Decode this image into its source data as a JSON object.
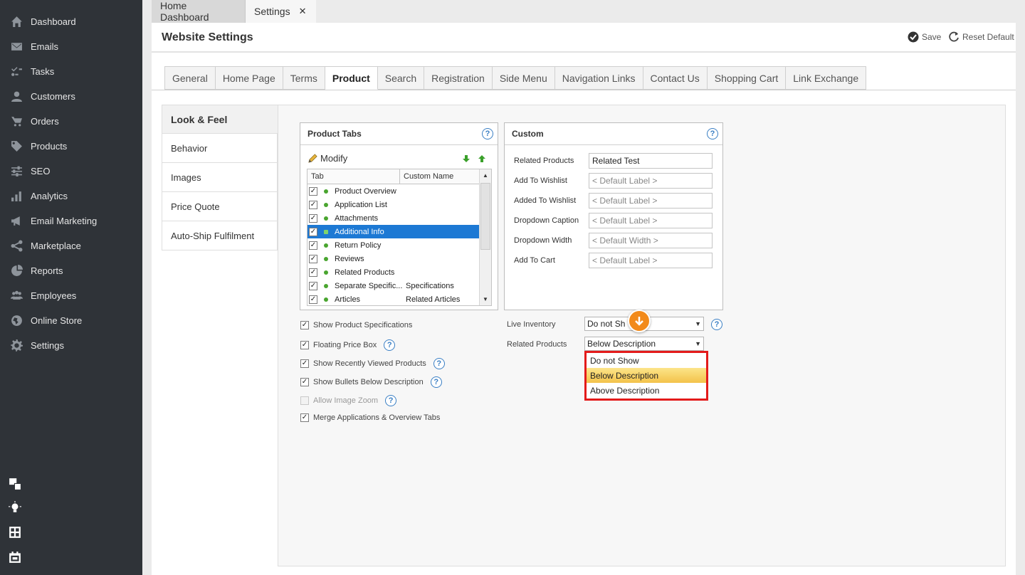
{
  "sidebar": {
    "items": [
      {
        "label": "Dashboard",
        "icon": "home-icon"
      },
      {
        "label": "Emails",
        "icon": "envelope-icon"
      },
      {
        "label": "Tasks",
        "icon": "tasks-icon"
      },
      {
        "label": "Customers",
        "icon": "user-icon"
      },
      {
        "label": "Orders",
        "icon": "cart-icon"
      },
      {
        "label": "Products",
        "icon": "tag-icon"
      },
      {
        "label": "SEO",
        "icon": "sliders-icon"
      },
      {
        "label": "Analytics",
        "icon": "bar-chart-icon"
      },
      {
        "label": "Email Marketing",
        "icon": "megaphone-icon"
      },
      {
        "label": "Marketplace",
        "icon": "share-icon"
      },
      {
        "label": "Reports",
        "icon": "pie-chart-icon"
      },
      {
        "label": "Employees",
        "icon": "users-icon"
      },
      {
        "label": "Online Store",
        "icon": "globe-icon"
      },
      {
        "label": "Settings",
        "icon": "gear-icon"
      }
    ],
    "bottom_icons": [
      "windows-icon",
      "lightbulb-icon",
      "calculator-icon",
      "calendar-icon"
    ]
  },
  "doc_tabs": [
    {
      "label": "Home Dashboard"
    },
    {
      "label": "Settings",
      "close": "✕"
    }
  ],
  "header": {
    "title": "Website Settings",
    "save_label": "Save",
    "reset_label": "Reset Default"
  },
  "settings_tabs": [
    "General",
    "Home Page",
    "Terms",
    "Product",
    "Search",
    "Registration",
    "Side Menu",
    "Navigation Links",
    "Contact Us",
    "Shopping Cart",
    "Link Exchange"
  ],
  "active_settings_tab": "Product",
  "left_nav": [
    "Look & Feel",
    "Behavior",
    "Images",
    "Price Quote",
    "Auto-Ship Fulfilment"
  ],
  "active_left_nav": "Look & Feel",
  "product_tabs": {
    "title": "Product Tabs",
    "help": "?",
    "modify_label": "Modify",
    "columns": [
      "Tab",
      "Custom Name"
    ],
    "rows": [
      {
        "name": "Product Overview",
        "custom": "",
        "checked": true
      },
      {
        "name": "Application List",
        "custom": "",
        "checked": true
      },
      {
        "name": "Attachments",
        "custom": "",
        "checked": true
      },
      {
        "name": "Additional Info",
        "custom": "",
        "checked": true,
        "selected": true
      },
      {
        "name": "Return Policy",
        "custom": "",
        "checked": true
      },
      {
        "name": "Reviews",
        "custom": "",
        "checked": true
      },
      {
        "name": "Related Products",
        "custom": "",
        "checked": true
      },
      {
        "name": "Separate Specific...",
        "custom": "Specifications",
        "checked": true
      },
      {
        "name": "Articles",
        "custom": "Related Articles",
        "checked": true
      }
    ]
  },
  "custom_panel": {
    "title": "Custom",
    "help": "?",
    "fields": [
      {
        "label": "Related Products",
        "value": "Related Test",
        "placeholder": false
      },
      {
        "label": "Add To Wishlist",
        "value": "< Default Label >",
        "placeholder": true
      },
      {
        "label": "Added To Wishlist",
        "value": "< Default Label >",
        "placeholder": true
      },
      {
        "label": "Dropdown  Caption",
        "value": "< Default Label >",
        "placeholder": true
      },
      {
        "label": "Dropdown  Width",
        "value": "< Default Width >",
        "placeholder": true
      },
      {
        "label": "Add To Cart",
        "value": "< Default Label >",
        "placeholder": true
      }
    ]
  },
  "options": [
    {
      "label": "Show Product Specifications",
      "checked": true,
      "help": false,
      "disabled": false
    },
    {
      "label": "Floating Price Box",
      "checked": true,
      "help": true,
      "disabled": false
    },
    {
      "label": "Show Recently Viewed Products",
      "checked": true,
      "help": true,
      "disabled": false
    },
    {
      "label": "Show Bullets Below Description",
      "checked": true,
      "help": true,
      "disabled": false
    },
    {
      "label": "Allow Image Zoom",
      "checked": false,
      "help": true,
      "disabled": true
    },
    {
      "label": "Merge Applications & Overview Tabs",
      "checked": true,
      "help": false,
      "disabled": false
    }
  ],
  "live_inventory": {
    "label": "Live Inventory",
    "value": "Do not Sh"
  },
  "related_products_select": {
    "label": "Related Products",
    "value": "Below Description",
    "options": [
      "Do not Show",
      "Below Description",
      "Above Description"
    ],
    "highlighted": "Below Description"
  },
  "glyphs": {
    "check": "✓",
    "caret": "▼",
    "up": "▲",
    "down": "▼",
    "help": "?"
  },
  "colors": {
    "sidebar": "#2f3338",
    "selection": "#1d79d4",
    "highlight_border": "#e31b1b",
    "badge": "#f28a1a",
    "dot": "#49a52f"
  }
}
